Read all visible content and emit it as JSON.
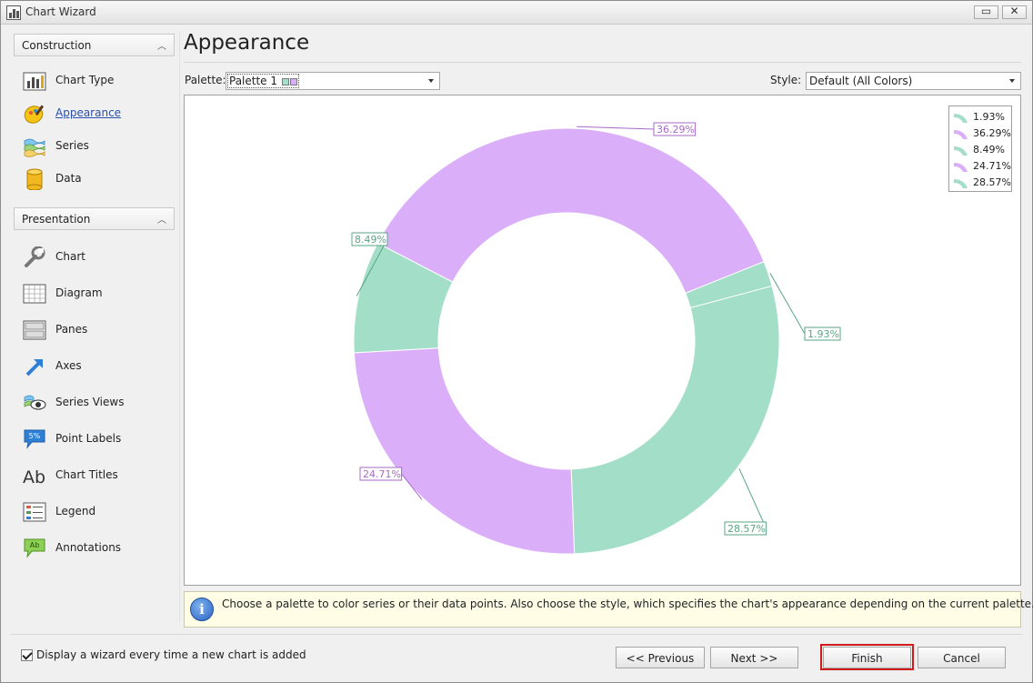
{
  "window": {
    "title": "Chart Wizard",
    "maximize_glyph": "▭",
    "close_glyph": "✕"
  },
  "sidebar": {
    "groups": [
      {
        "label": "Construction",
        "items": [
          {
            "label": "Chart Type",
            "icon": "chart-type-icon"
          },
          {
            "label": "Appearance",
            "icon": "palette-icon",
            "active": true
          },
          {
            "label": "Series",
            "icon": "series-icon"
          },
          {
            "label": "Data",
            "icon": "database-icon"
          }
        ]
      },
      {
        "label": "Presentation",
        "items": [
          {
            "label": "Chart",
            "icon": "wrench-icon"
          },
          {
            "label": "Diagram",
            "icon": "diagram-icon"
          },
          {
            "label": "Panes",
            "icon": "panes-icon"
          },
          {
            "label": "Axes",
            "icon": "axes-arrow-icon"
          },
          {
            "label": "Series Views",
            "icon": "series-views-icon"
          },
          {
            "label": "Point Labels",
            "icon": "point-labels-icon"
          },
          {
            "label": "Chart Titles",
            "icon": "chart-titles-icon"
          },
          {
            "label": "Legend",
            "icon": "legend-icon"
          },
          {
            "label": "Annotations",
            "icon": "annotations-icon"
          }
        ]
      }
    ]
  },
  "main": {
    "title": "Appearance",
    "palette_label": "Palette:",
    "palette_value": "Palette 1",
    "style_label": "Style:",
    "style_value": "Default (All Colors)"
  },
  "colors": {
    "green": "#a3dfc8",
    "purple": "#dbaefa",
    "green_label": "#5aa585",
    "purple_label": "#a66bc7"
  },
  "chart_data": {
    "type": "pie",
    "variant": "doughnut",
    "values": [
      1.93,
      36.29,
      8.49,
      24.71,
      28.57
    ],
    "labels": [
      "1.93%",
      "36.29%",
      "8.49%",
      "24.71%",
      "28.57%"
    ],
    "slice_colors": [
      "green",
      "purple",
      "green",
      "purple",
      "green"
    ],
    "legend": {
      "placement": "top-right",
      "entries": [
        "1.93%",
        "36.29%",
        "8.49%",
        "24.71%",
        "28.57%"
      ]
    }
  },
  "info": {
    "icon": "info-icon",
    "text": "Choose a palette to color series or their data points. Also choose the style, which specifies the chart's appearance depending on the current palette."
  },
  "footer": {
    "checkbox_label": "Display a wizard every time a new chart is added",
    "checkbox_checked": true,
    "previous_label": "<< Previous",
    "next_label": "Next >>",
    "finish_label": "Finish",
    "cancel_label": "Cancel"
  }
}
